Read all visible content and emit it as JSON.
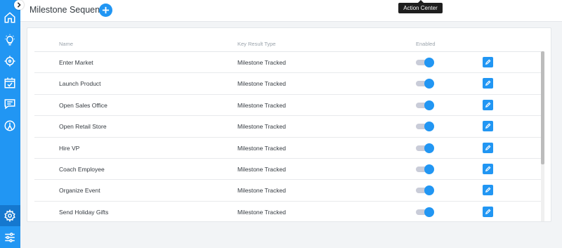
{
  "sidebar": {
    "icons": [
      "home-icon",
      "lightbulb-icon",
      "target-icon",
      "calendar-check-icon",
      "chat-icon",
      "gauge-icon",
      "gear-icon",
      "sliders-icon"
    ],
    "active": "gear-icon"
  },
  "header": {
    "title": "Milestone Sequence",
    "tooltip": "Action Center"
  },
  "table": {
    "columns": {
      "name": "Name",
      "type": "Key Result Type",
      "enabled": "Enabled"
    },
    "rows": [
      {
        "name": "Enter Market",
        "type": "Milestone Tracked",
        "enabled": true
      },
      {
        "name": "Launch Product",
        "type": "Milestone Tracked",
        "enabled": true
      },
      {
        "name": "Open Sales Office",
        "type": "Milestone Tracked",
        "enabled": true
      },
      {
        "name": "Open Retail Store",
        "type": "Milestone Tracked",
        "enabled": true
      },
      {
        "name": "Hire VP",
        "type": "Milestone Tracked",
        "enabled": true
      },
      {
        "name": "Coach Employee",
        "type": "Milestone Tracked",
        "enabled": true
      },
      {
        "name": "Organize Event",
        "type": "Milestone Tracked",
        "enabled": true
      },
      {
        "name": "Send Holiday Gifts",
        "type": "Milestone Tracked",
        "enabled": true
      }
    ]
  },
  "colors": {
    "accent": "#2196f3",
    "sidebar": "#2196f3",
    "sidebar_active": "#1578cf",
    "toggle_track": "#c9ccd8"
  }
}
